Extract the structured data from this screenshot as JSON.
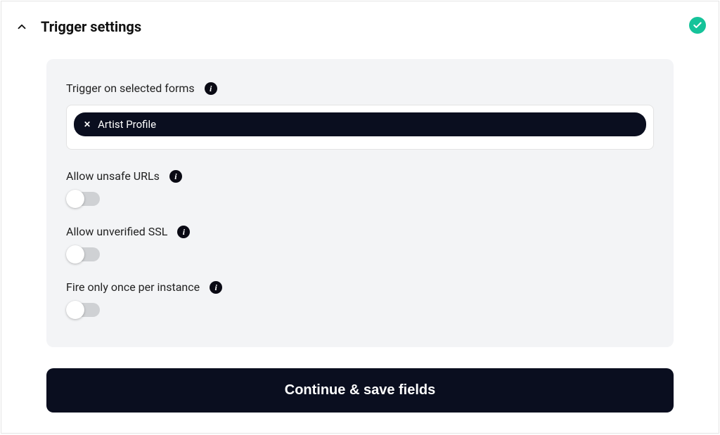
{
  "header": {
    "title": "Trigger settings"
  },
  "panel": {
    "forms": {
      "label": "Trigger on selected forms",
      "chip": "Artist Profile"
    },
    "unsafe": {
      "label": "Allow unsafe URLs"
    },
    "ssl": {
      "label": "Allow unverified SSL"
    },
    "once": {
      "label": "Fire only once per instance"
    }
  },
  "infoGlyph": "i",
  "cta": "Continue & save fields"
}
